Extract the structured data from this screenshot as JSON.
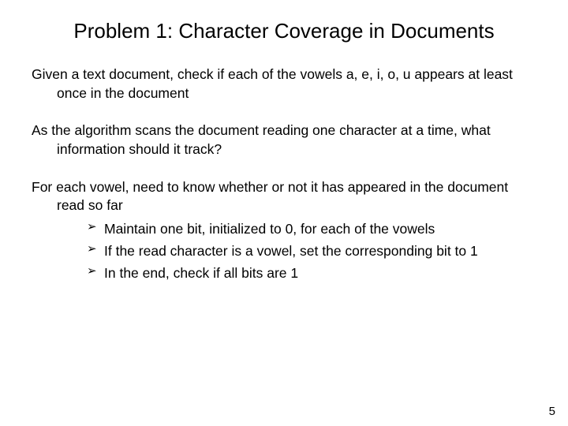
{
  "title": "Problem 1: Character Coverage in Documents",
  "para1": "Given a text document, check if each of the vowels a, e, i, o, u appears at least once in the document",
  "para2": "As the algorithm scans the document reading one character at a time, what information should it track?",
  "para3_intro": "For each vowel, need to know whether or not it has appeared in the document read so far",
  "bullets": {
    "b1": "Maintain one bit, initialized to 0, for each of the vowels",
    "b2": "If the read character is a vowel, set the corresponding bit to 1",
    "b3": "In the end, check if all bits are 1"
  },
  "page_number": "5"
}
